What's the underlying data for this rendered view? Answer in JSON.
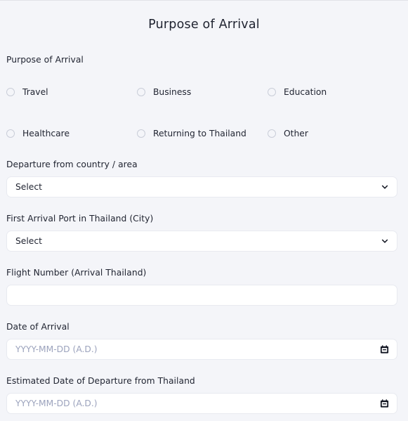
{
  "header": {
    "title": "Purpose of Arrival"
  },
  "form": {
    "purpose": {
      "label": "Purpose of Arrival",
      "options": [
        {
          "label": "Travel",
          "selected": false
        },
        {
          "label": "Business",
          "selected": false
        },
        {
          "label": "Education",
          "selected": false
        },
        {
          "label": "Healthcare",
          "selected": false
        },
        {
          "label": "Returning to Thailand",
          "selected": false
        },
        {
          "label": "Other",
          "selected": false
        }
      ]
    },
    "departure_country": {
      "label": "Departure from country / area",
      "value": "Select",
      "icon": "chevron-down-icon"
    },
    "arrival_port": {
      "label": "First Arrival Port in Thailand (City)",
      "value": "Select",
      "icon": "chevron-down-icon"
    },
    "flight_number": {
      "label": "Flight Number (Arrival Thailand)",
      "value": "",
      "placeholder": ""
    },
    "date_of_arrival": {
      "label": "Date of Arrival",
      "value": "",
      "placeholder": "YYYY-MM-DD (A.D.)",
      "icon": "calendar-icon"
    },
    "date_of_departure": {
      "label": "Estimated Date of Departure from Thailand",
      "value": "",
      "placeholder": "YYYY-MM-DD (A.D.)",
      "icon": "calendar-icon"
    }
  },
  "colors": {
    "background": "#f4f5f9",
    "field_background": "#ffffff",
    "text": "#1f2330",
    "placeholder": "#9ca3bd",
    "border": "#e8eaf0",
    "radio_border": "#c9cdd8"
  }
}
